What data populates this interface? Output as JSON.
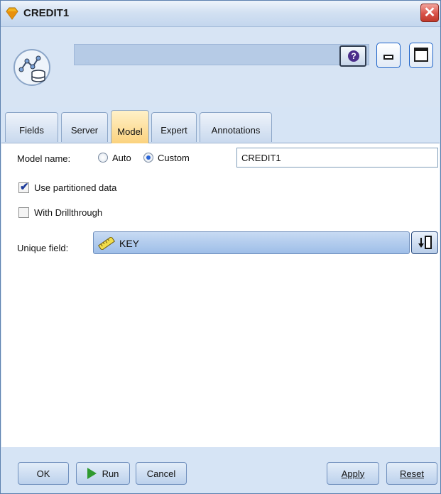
{
  "window": {
    "title": "CREDIT1",
    "close_glyph": "✕"
  },
  "header": {
    "help_glyph": "?"
  },
  "tabs": [
    {
      "label": "Fields"
    },
    {
      "label": "Server"
    },
    {
      "label": "Model",
      "active": true
    },
    {
      "label": "Expert"
    },
    {
      "label": "Annotations"
    }
  ],
  "model": {
    "model_name_label": "Model name:",
    "auto_label": "Auto",
    "custom_label": "Custom",
    "selected_mode": "Custom",
    "model_name_value": "CREDIT1",
    "use_partitioned_label": "Use partitioned data",
    "use_partitioned_checked": true,
    "drillthrough_label": "With Drillthrough",
    "drillthrough_checked": false,
    "unique_field_label": "Unique field:",
    "unique_field_value": "KEY",
    "check_glyph": "✔"
  },
  "footer": {
    "ok_label": "OK",
    "run_label": "Run",
    "cancel_label": "Cancel",
    "apply_label": "Apply",
    "reset_label": "Reset"
  },
  "icons": {
    "app": "diamond-app-icon",
    "node": "database-model-node-icon",
    "field_type": "ruler-icon",
    "picker": "field-picker-icon",
    "run": "play-icon"
  },
  "colors": {
    "active_tab": "#fbd27e",
    "field_select": "#9ebee8",
    "run_arrow": "#2f9a2f",
    "close": "#d9534a"
  }
}
